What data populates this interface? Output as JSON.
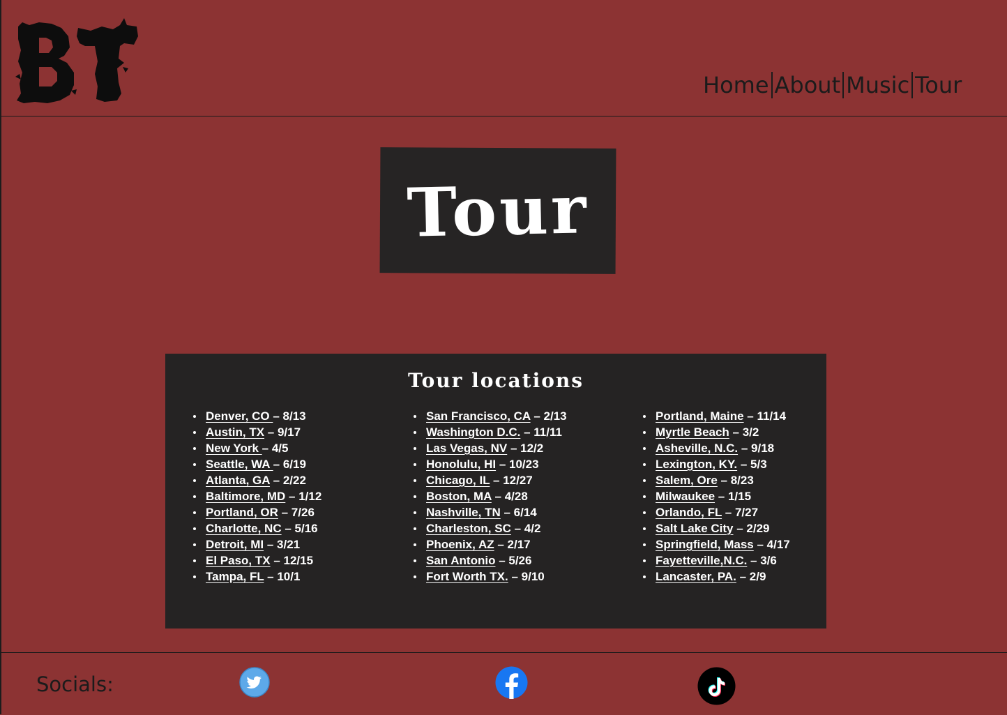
{
  "header": {
    "logo_text": "BT",
    "nav": [
      {
        "label": "Home"
      },
      {
        "label": "About"
      },
      {
        "label": "Music"
      },
      {
        "label": "Tour"
      }
    ]
  },
  "hero": {
    "title": "Tour"
  },
  "tour_panel": {
    "title": "Tour locations",
    "columns": [
      [
        {
          "city": "Denver, CO ",
          "date": " – 8/13"
        },
        {
          "city": "Austin, TX",
          "date": " – 9/17"
        },
        {
          "city": "New York ",
          "date": " – 4/5"
        },
        {
          "city": "Seattle, WA ",
          "date": " – 6/19"
        },
        {
          "city": "Atlanta, GA",
          "date": " – 2/22"
        },
        {
          "city": "Baltimore, MD",
          "date": " – 1/12"
        },
        {
          "city": "Portland, OR",
          "date": " – 7/26"
        },
        {
          "city": "Charlotte, NC",
          "date": " – 5/16"
        },
        {
          "city": "Detroit, MI",
          "date": " – 3/21"
        },
        {
          "city": "El Paso, TX",
          "date": " – 12/15"
        },
        {
          "city": "Tampa, FL",
          "date": " – 10/1"
        }
      ],
      [
        {
          "city": "San Francisco, CA",
          "date": " – 2/13"
        },
        {
          "city": "Washington D.C.",
          "date": " – 11/11"
        },
        {
          "city": " Las Vegas, NV",
          "date": " – 12/2"
        },
        {
          "city": "Honolulu, HI",
          "date": " – 10/23"
        },
        {
          "city": "Chicago, IL",
          "date": " – 12/27"
        },
        {
          "city": " Boston, MA",
          "date": " – 4/28"
        },
        {
          "city": "Nashville, TN",
          "date": " – 6/14"
        },
        {
          "city": "Charleston, SC",
          "date": " – 4/2"
        },
        {
          "city": "Phoenix, AZ",
          "date": " – 2/17"
        },
        {
          "city": "San Antonio",
          "date": " – 5/26"
        },
        {
          "city": "Fort Worth TX.",
          "date": " – 9/10"
        }
      ],
      [
        {
          "city": "Portland, Maine",
          "date": " – 11/14"
        },
        {
          "city": "Myrtle Beach",
          "date": " – 3/2"
        },
        {
          "city": "Asheville, N.C.",
          "date": " – 9/18"
        },
        {
          "city": "Lexington, KY.",
          "date": " – 5/3"
        },
        {
          "city": "Salem, Ore",
          "date": " – 8/23"
        },
        {
          "city": "Milwaukee",
          "date": " – 1/15"
        },
        {
          "city": "Orlando, FL",
          "date": " – 7/27"
        },
        {
          "city": "Salt Lake City",
          "date": " – 2/29"
        },
        {
          "city": "Springfield, Mass",
          "date": " – 4/17"
        },
        {
          "city": "Fayetteville,N.C.",
          "date": " – 3/6"
        },
        {
          "city": "Lancaster, PA.",
          "date": " – 2/9"
        }
      ]
    ]
  },
  "footer": {
    "socials_label": "Socials:",
    "icons": [
      "twitter-icon",
      "facebook-icon",
      "tiktok-icon"
    ]
  },
  "colors": {
    "page_background": "#8c3333",
    "panel_background": "#252323",
    "text_light": "#ffffff",
    "text_dark": "#1b1b1b",
    "twitter": "#5da9e9",
    "facebook": "#1877f2",
    "tiktok": "#000000"
  }
}
